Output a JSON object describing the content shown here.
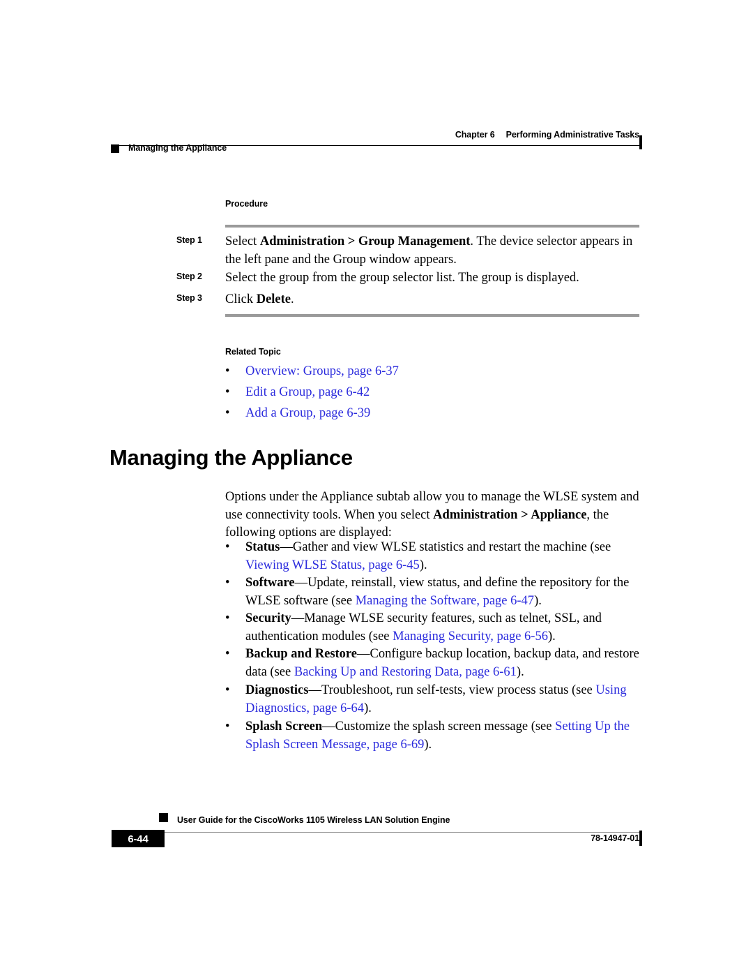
{
  "header": {
    "chapter_label": "Chapter 6",
    "chapter_title": "Performing Administrative Tasks",
    "running_head": "Managing the Appliance"
  },
  "procedure": {
    "heading": "Procedure",
    "steps": [
      {
        "label": "Step 1",
        "text_before": "Select ",
        "bold": "Administration > Group Management",
        "text_after": ". The device selector appears in the left pane and the Group window appears."
      },
      {
        "label": "Step 2",
        "text_before": "Select the group from the group selector list. The group is displayed.",
        "bold": "",
        "text_after": ""
      },
      {
        "label": "Step 3",
        "text_before": "Click ",
        "bold": "Delete",
        "text_after": "."
      }
    ]
  },
  "related_topic": {
    "heading": "Related Topic",
    "bullet": "•",
    "links": [
      "Overview: Groups, page 6-37",
      "Edit a Group, page 6-42",
      "Add a Group, page 6-39"
    ]
  },
  "section": {
    "title": "Managing the Appliance",
    "intro_part1": "Options under the Appliance subtab allow you to manage the WLSE system and use connectivity tools. When you select ",
    "intro_bold": "Administration > Appliance",
    "intro_part2": ", the following options are displayed:",
    "bullet": "•",
    "options": [
      {
        "term": "Status",
        "desc_before": "—Gather and view WLSE statistics and restart the machine (see ",
        "link": "Viewing WLSE Status, page 6-45",
        "desc_after": ")."
      },
      {
        "term": "Software",
        "desc_before": "—Update, reinstall, view status, and define the repository for the WLSE software (see ",
        "link": "Managing the Software, page 6-47",
        "desc_after": ")."
      },
      {
        "term": "Security",
        "desc_before": "—Manage WLSE security features, such as telnet, SSL, and authentication modules (see ",
        "link": "Managing Security, page 6-56",
        "desc_after": ")."
      },
      {
        "term": "Backup and Restore",
        "desc_before": "—Configure backup location, backup data, and restore data (see ",
        "link": "Backing Up and Restoring Data, page 6-61",
        "desc_after": ")."
      },
      {
        "term": "Diagnostics",
        "desc_before": "—Troubleshoot, run self-tests, view process status (see ",
        "link": "Using Diagnostics, page 6-64",
        "desc_after": ")."
      },
      {
        "term": "Splash Screen",
        "desc_before": "—Customize the splash screen message (see ",
        "link": "Setting Up the Splash Screen Message, page 6-69",
        "desc_after": ")."
      }
    ]
  },
  "footer": {
    "guide_title": "User Guide for the CiscoWorks 1105 Wireless LAN Solution Engine",
    "page_number": "6-44",
    "doc_number": "78-14947-01"
  },
  "colors": {
    "link": "#2b2bdd",
    "rule_gray": "#9a9a9a",
    "text": "#000000"
  }
}
